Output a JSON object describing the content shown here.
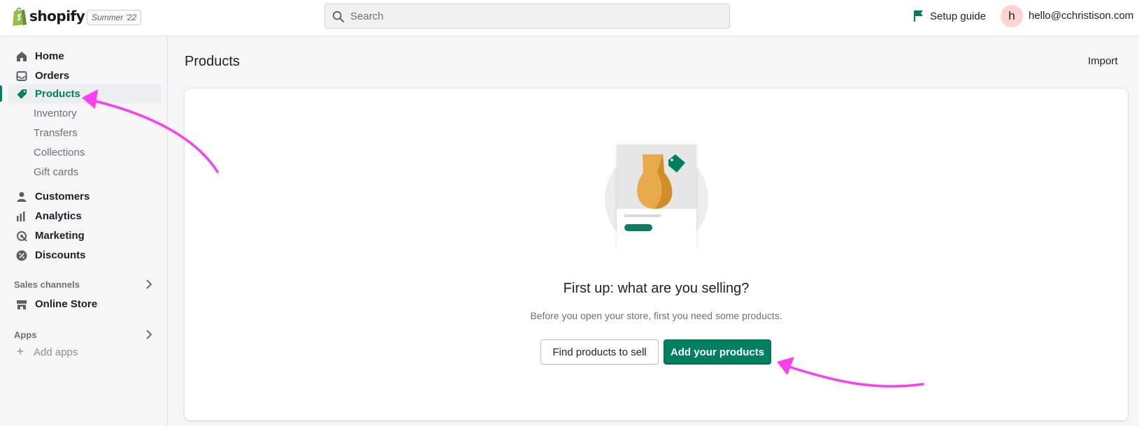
{
  "brand": {
    "name": "shopify",
    "edition": "Summer '22"
  },
  "search": {
    "placeholder": "Search"
  },
  "header": {
    "setup_guide": "Setup guide",
    "avatar_initial": "h",
    "user_email": "hello@cchristison.com"
  },
  "sidebar": {
    "items": [
      {
        "label": "Home",
        "icon": "home-icon"
      },
      {
        "label": "Orders",
        "icon": "orders-icon"
      },
      {
        "label": "Products",
        "icon": "tag-icon",
        "active": true
      },
      {
        "label": "Customers",
        "icon": "person-icon"
      },
      {
        "label": "Analytics",
        "icon": "bar-chart-icon"
      },
      {
        "label": "Marketing",
        "icon": "marketing-icon"
      },
      {
        "label": "Discounts",
        "icon": "discount-icon"
      }
    ],
    "product_subitems": [
      "Inventory",
      "Transfers",
      "Collections",
      "Gift cards"
    ],
    "sales_channels": {
      "title": "Sales channels",
      "items": [
        {
          "label": "Online Store",
          "icon": "store-icon"
        }
      ]
    },
    "apps": {
      "title": "Apps",
      "add_label": "Add apps"
    }
  },
  "main": {
    "title": "Products",
    "import_label": "Import",
    "empty_state": {
      "heading": "First up: what are you selling?",
      "text": "Before you open your store, first you need some products.",
      "secondary_button": "Find products to sell",
      "primary_button": "Add your products"
    }
  },
  "colors": {
    "accent": "#008060",
    "annotation_arrow": "#ff3df0",
    "avatar_bg": "#fed3d1"
  }
}
